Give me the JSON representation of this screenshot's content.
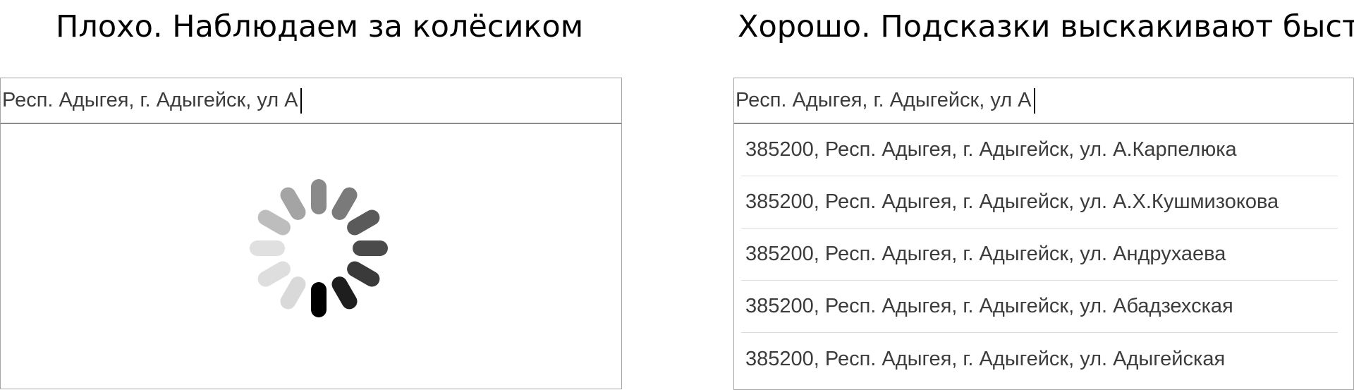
{
  "left": {
    "heading": "Плохо. Наблюдаем за колёсиком",
    "input_value": "Респ. Адыгея, г. Адыгейск, ул А",
    "spinner_icon": "loading-spinner-icon"
  },
  "right": {
    "heading": "Хорошо. Подсказки выскакивают быстро",
    "input_value": "Респ. Адыгея, г. Адыгейск, ул А",
    "suggestions": [
      "385200, Респ. Адыгея, г. Адыгейск, ул. А.Карпелюка",
      "385200, Респ. Адыгея, г. Адыгейск, ул. А.Х.Кушмизокова",
      "385200, Респ. Адыгея, г. Адыгейск, ул. Андрухаева",
      "385200, Респ. Адыгея, г. Адыгейск, ул. Абадзехская",
      "385200, Респ. Адыгея, г. Адыгейск, ул. Адыгейская"
    ]
  }
}
